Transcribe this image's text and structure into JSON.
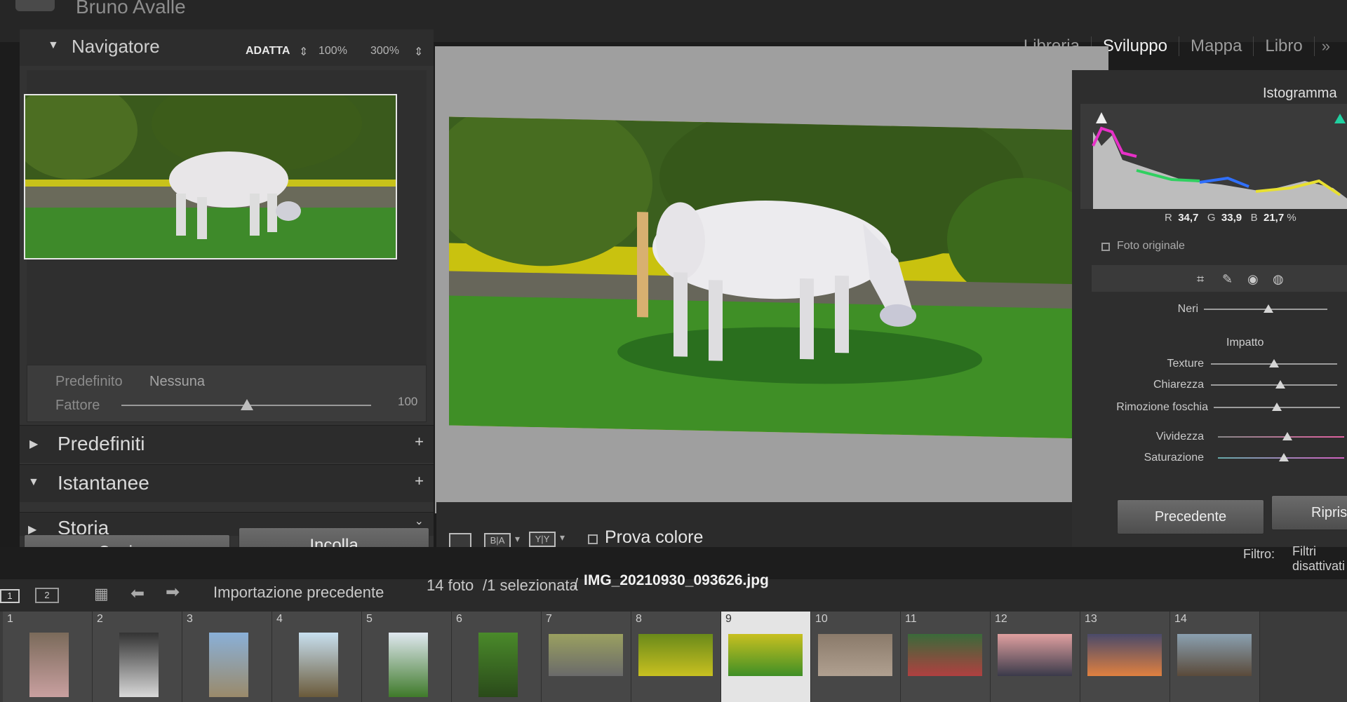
{
  "app": {
    "catalog_name": "Bruno Avalle"
  },
  "modules": [
    "Libreria",
    "Sviluppo",
    "Mappa",
    "Libro",
    "»"
  ],
  "active_module": "Sviluppo",
  "navigator": {
    "title": "Navigatore",
    "zoom_options": [
      "ADATTA",
      "100%",
      "300%"
    ],
    "zoom_selected": "ADATTA"
  },
  "preset_area": {
    "preset_label": "Predefinito",
    "preset_value": "Nessuna",
    "factor_label": "Fattore",
    "factor_value": "100"
  },
  "sections": [
    {
      "title": "Predefiniti",
      "expanded": false
    },
    {
      "title": "Istantanee",
      "expanded": true
    },
    {
      "title": "Storia",
      "expanded": false
    }
  ],
  "buttons": {
    "copy": "Copia...",
    "paste": "Incolla",
    "previous": "Precedente",
    "reset": "Ripristina"
  },
  "toolbar": {
    "view_ba": "B|A",
    "view_yy": "Y|Y",
    "proof_label": "Prova colore",
    "proof_checked": false
  },
  "histogram": {
    "title": "Istogramma",
    "r_label": "R",
    "r_value": "34,7",
    "g_label": "G",
    "g_value": "33,9",
    "b_label": "B",
    "b_value": "21,7",
    "unit": "%",
    "original_label": "Foto originale"
  },
  "adjustments": {
    "neri": {
      "label": "Neri",
      "value": 0.52
    },
    "group_label": "Impatto",
    "texture": {
      "label": "Texture",
      "value": 0.5
    },
    "chiarezza": {
      "label": "Chiarezza",
      "value": 0.55
    },
    "rimozione": {
      "label": "Rimozione foschia",
      "value": 0.5
    },
    "vividezza": {
      "label": "Vividezza",
      "value": 0.55
    },
    "saturazione": {
      "label": "Saturazione",
      "value": 0.52
    }
  },
  "filter": {
    "label": "Filtro:",
    "value": "Filtri disattivati"
  },
  "filmstrip": {
    "view_1": "1",
    "view_2": "2",
    "source": "Importazione precedente",
    "count": "14 foto",
    "selected": "/1 selezionata",
    "separator": "/",
    "filename": "IMG_20210930_093626.jpg",
    "selected_index": 9,
    "cells": [
      "1",
      "2",
      "3",
      "4",
      "5",
      "6",
      "7",
      "8",
      "9",
      "10",
      "11",
      "12",
      "13",
      "14"
    ]
  },
  "colors": {
    "accent": "#e4e4e4",
    "panel": "#333333",
    "background": "#1c1c1c"
  }
}
